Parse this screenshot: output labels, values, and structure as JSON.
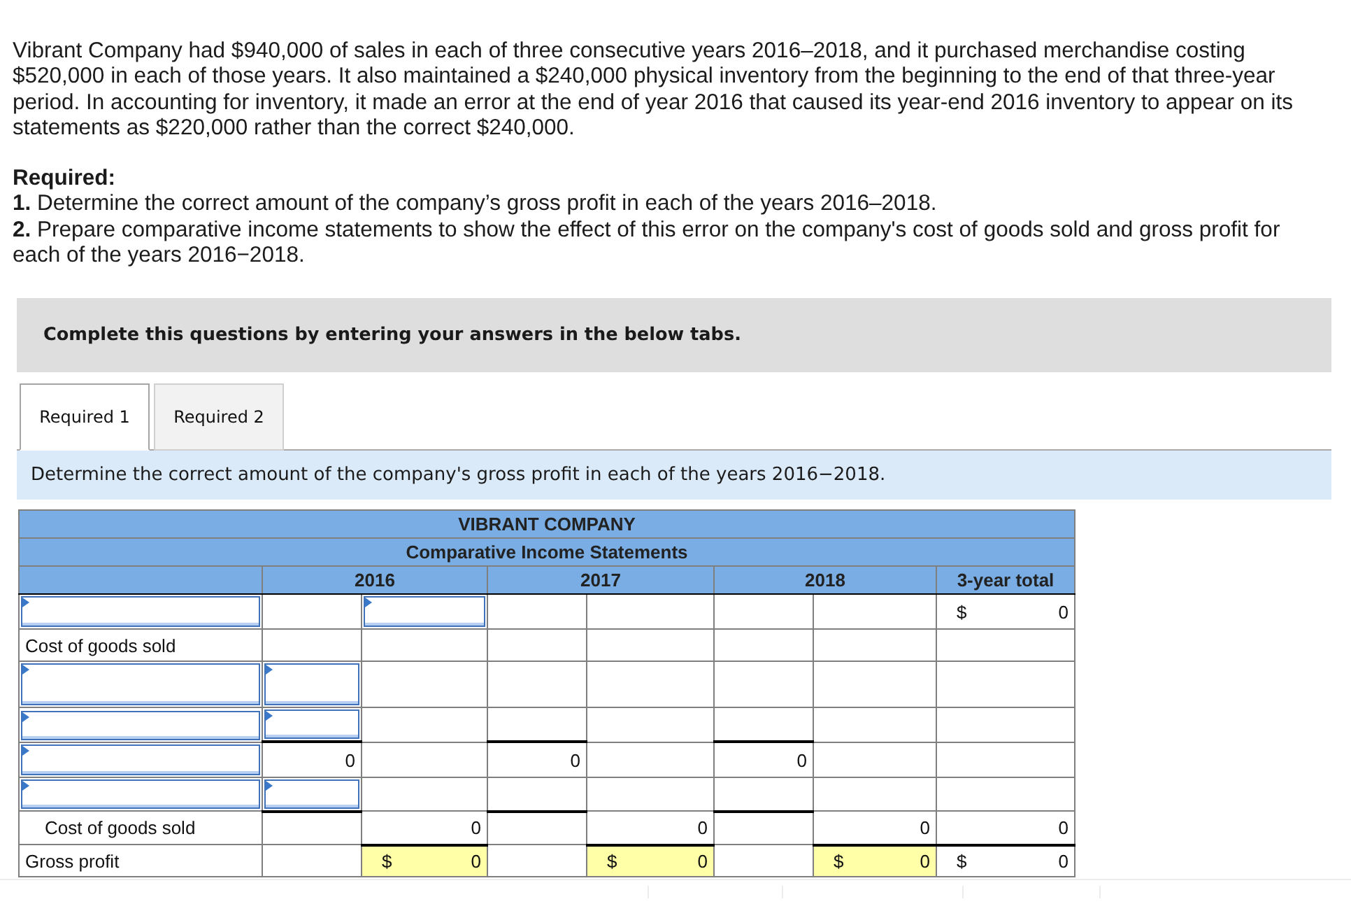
{
  "problem": {
    "statement": "Vibrant Company had $940,000 of sales in each of three consecutive years 2016–2018, and it purchased merchandise costing $520,000 in each of those years. It also maintained a $240,000 physical inventory from the beginning to the end of that three-year period. In accounting for inventory, it made an error at the end of year 2016 that caused its year-end 2016 inventory to appear on its statements as $220,000 rather than the correct $240,000.",
    "required_heading": "Required:",
    "requirements": [
      "**1.** Determine the correct amount of the company’s gross profit in each of the years 2016–2018.",
      "**2.** Prepare comparative income statements to show the effect of this error on the company's cost of goods sold and gross profit for each of the years 2016−2018."
    ]
  },
  "instruction_banner": "Complete this questions by entering your answers in the below tabs.",
  "tabs": [
    {
      "label": "Required 1",
      "selected": true
    },
    {
      "label": "Required 2",
      "selected": false
    }
  ],
  "task_prompt": "Determine the correct amount of the company's gross profit in each of the years 2016−2018.",
  "statement": {
    "title": "VIBRANT COMPANY",
    "subtitle": "Comparative Income Statements",
    "year_columns": [
      "2016",
      "2017",
      "2018"
    ],
    "total_column": "3-year total",
    "rows": [
      {
        "label": {
          "kind": "input"
        },
        "cells": [
          {
            "kind": "empty",
            "rule_above": false,
            "highlight": false
          },
          {
            "kind": "input"
          },
          {
            "kind": "empty",
            "rule_above": false,
            "highlight": false
          },
          {
            "kind": "empty",
            "rule_above": false,
            "highlight": false
          },
          {
            "kind": "empty",
            "rule_above": false,
            "highlight": false
          },
          {
            "kind": "empty",
            "rule_above": false,
            "highlight": false
          },
          {
            "kind": "amount",
            "currency": "$",
            "text": "0",
            "rule_above": false,
            "highlight": false
          }
        ]
      },
      {
        "label": {
          "kind": "heading",
          "text": "Cost of goods sold"
        },
        "cells": [
          {
            "kind": "empty",
            "rule_above": false,
            "highlight": false
          },
          {
            "kind": "empty",
            "rule_above": false,
            "highlight": false
          },
          {
            "kind": "empty",
            "rule_above": false,
            "highlight": false
          },
          {
            "kind": "empty",
            "rule_above": false,
            "highlight": false
          },
          {
            "kind": "empty",
            "rule_above": false,
            "highlight": false
          },
          {
            "kind": "empty",
            "rule_above": false,
            "highlight": false
          },
          {
            "kind": "empty",
            "rule_above": false,
            "highlight": false
          }
        ]
      },
      {
        "label": {
          "kind": "input"
        },
        "cells": [
          {
            "kind": "input"
          },
          {
            "kind": "empty",
            "rule_above": false,
            "highlight": false
          },
          {
            "kind": "empty",
            "rule_above": false,
            "highlight": false
          },
          {
            "kind": "empty",
            "rule_above": false,
            "highlight": false
          },
          {
            "kind": "empty",
            "rule_above": false,
            "highlight": false
          },
          {
            "kind": "empty",
            "rule_above": false,
            "highlight": false
          },
          {
            "kind": "empty",
            "rule_above": false,
            "highlight": false
          }
        ]
      },
      {
        "label": {
          "kind": "input"
        },
        "cells": [
          {
            "kind": "input"
          },
          {
            "kind": "empty",
            "rule_above": false,
            "highlight": false
          },
          {
            "kind": "empty",
            "rule_above": false,
            "highlight": false
          },
          {
            "kind": "empty",
            "rule_above": false,
            "highlight": false
          },
          {
            "kind": "empty",
            "rule_above": false,
            "highlight": false
          },
          {
            "kind": "empty",
            "rule_above": false,
            "highlight": false
          },
          {
            "kind": "empty",
            "rule_above": false,
            "highlight": false
          }
        ]
      },
      {
        "label": {
          "kind": "input"
        },
        "cells": [
          {
            "kind": "amount",
            "text": "0",
            "rule_above": true,
            "highlight": false
          },
          {
            "kind": "empty",
            "rule_above": false,
            "highlight": false
          },
          {
            "kind": "amount",
            "text": "0",
            "rule_above": true,
            "highlight": false
          },
          {
            "kind": "empty",
            "rule_above": false,
            "highlight": false
          },
          {
            "kind": "amount",
            "text": "0",
            "rule_above": true,
            "highlight": false
          },
          {
            "kind": "empty",
            "rule_above": false,
            "highlight": false
          },
          {
            "kind": "empty",
            "rule_above": false,
            "highlight": false
          }
        ]
      },
      {
        "label": {
          "kind": "input"
        },
        "cells": [
          {
            "kind": "input"
          },
          {
            "kind": "empty",
            "rule_above": false,
            "highlight": false
          },
          {
            "kind": "empty",
            "rule_above": false,
            "highlight": false
          },
          {
            "kind": "empty",
            "rule_above": false,
            "highlight": false
          },
          {
            "kind": "empty",
            "rule_above": false,
            "highlight": false
          },
          {
            "kind": "empty",
            "rule_above": false,
            "highlight": false
          },
          {
            "kind": "empty",
            "rule_above": false,
            "highlight": false
          }
        ]
      },
      {
        "label": {
          "kind": "subtotal",
          "text": "Cost of goods sold"
        },
        "cells": [
          {
            "kind": "empty",
            "rule_above": true,
            "highlight": false
          },
          {
            "kind": "amount",
            "text": "0",
            "rule_above": false,
            "highlight": false
          },
          {
            "kind": "empty",
            "rule_above": true,
            "highlight": false
          },
          {
            "kind": "amount",
            "text": "0",
            "rule_above": false,
            "highlight": false
          },
          {
            "kind": "empty",
            "rule_above": true,
            "highlight": false
          },
          {
            "kind": "amount",
            "text": "0",
            "rule_above": false,
            "highlight": false
          },
          {
            "kind": "amount",
            "text": "0",
            "rule_above": false,
            "highlight": false
          }
        ]
      },
      {
        "label": {
          "kind": "total",
          "text": "Gross profit"
        },
        "cells": [
          {
            "kind": "empty",
            "rule_above": false,
            "highlight": false
          },
          {
            "kind": "amount",
            "currency": "$",
            "text": "0",
            "rule_above": true,
            "highlight": true
          },
          {
            "kind": "empty",
            "rule_above": false,
            "highlight": false
          },
          {
            "kind": "amount",
            "currency": "$",
            "text": "0",
            "rule_above": true,
            "highlight": true
          },
          {
            "kind": "empty",
            "rule_above": false,
            "highlight": false
          },
          {
            "kind": "amount",
            "currency": "$",
            "text": "0",
            "rule_above": true,
            "highlight": true
          },
          {
            "kind": "amount",
            "currency": "$",
            "text": "0",
            "rule_above": true,
            "highlight": false
          }
        ]
      }
    ]
  }
}
